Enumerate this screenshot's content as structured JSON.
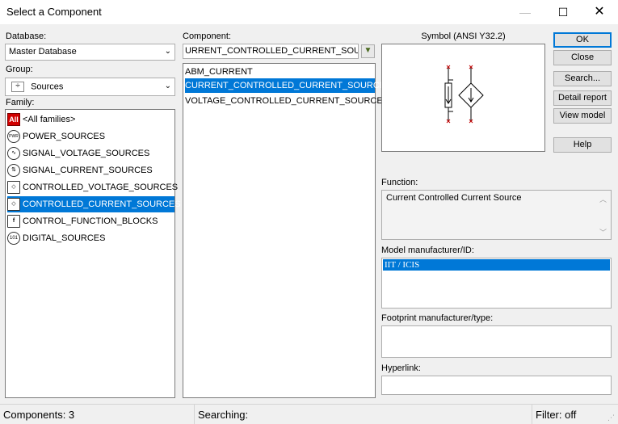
{
  "window": {
    "title": "Select a Component",
    "minimize": "—",
    "maximize": "☐",
    "close": "✕"
  },
  "database": {
    "label": "Database:",
    "value": "Master Database"
  },
  "group": {
    "label": "Group:",
    "value": "Sources",
    "icon": "sources-group-icon"
  },
  "family": {
    "label": "Family:",
    "items": [
      {
        "label": "<All families>",
        "icon": "All"
      },
      {
        "label": "POWER_SOURCES",
        "icon": "PWR"
      },
      {
        "label": "SIGNAL_VOLTAGE_SOURCES",
        "icon": "∿"
      },
      {
        "label": "SIGNAL_CURRENT_SOURCES",
        "icon": "⇅"
      },
      {
        "label": "CONTROLLED_VOLTAGE_SOURCES",
        "icon": "◇"
      },
      {
        "label": "CONTROLLED_CURRENT_SOURCES",
        "icon": "◇"
      },
      {
        "label": "CONTROL_FUNCTION_BLOCKS",
        "icon": "f"
      },
      {
        "label": "DIGITAL_SOURCES",
        "icon": "101"
      }
    ],
    "selected_index": 5
  },
  "component": {
    "label": "Component:",
    "search_value": "URRENT_CONTROLLED_CURRENT_SOURCE",
    "items": [
      "ABM_CURRENT",
      "CURRENT_CONTROLLED_CURRENT_SOURCE",
      "VOLTAGE_CONTROLLED_CURRENT_SOURCE"
    ],
    "selected_index": 1
  },
  "symbol": {
    "label": "Symbol (ANSI Y32.2)"
  },
  "buttons": {
    "ok": "OK",
    "close": "Close",
    "search": "Search...",
    "detail_report": "Detail report",
    "view_model": "View model",
    "help": "Help"
  },
  "function": {
    "label": "Function:",
    "value": "Current Controlled Current Source"
  },
  "model": {
    "label": "Model manufacturer/ID:",
    "items": [
      "IIT / ICIS"
    ]
  },
  "footprint": {
    "label": "Footprint manufacturer/type:"
  },
  "hyperlink": {
    "label": "Hyperlink:"
  },
  "status": {
    "components": "Components: 3",
    "searching": "Searching:",
    "filter": "Filter: off"
  },
  "colors": {
    "selection": "#0078d7",
    "symbol_pin": "#c00000"
  }
}
